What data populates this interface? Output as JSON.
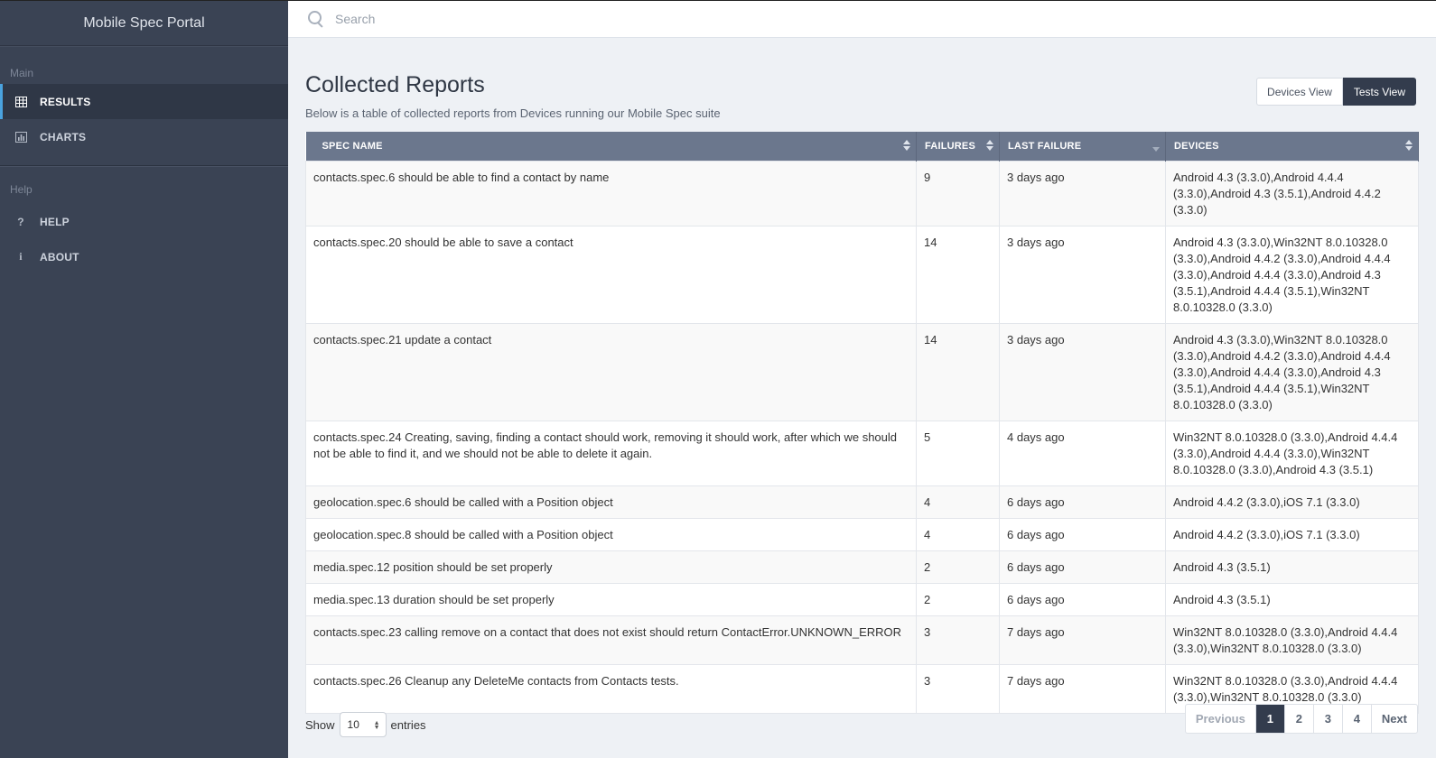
{
  "app": {
    "title": "Mobile Spec Portal"
  },
  "search": {
    "placeholder": "Search",
    "value": ""
  },
  "sidebar": {
    "sections": [
      {
        "label": "Main"
      },
      {
        "label": "Help"
      }
    ],
    "items": [
      {
        "label": "RESULTS",
        "icon": "table-icon",
        "active": true
      },
      {
        "label": "CHARTS",
        "icon": "bar-chart-icon",
        "active": false
      },
      {
        "label": "HELP",
        "icon": "question-icon",
        "active": false
      },
      {
        "label": "ABOUT",
        "icon": "info-icon",
        "active": false
      }
    ]
  },
  "page": {
    "title": "Collected Reports",
    "subtitle": "Below is a table of collected reports from Devices running our Mobile Spec suite",
    "views": [
      {
        "label": "Devices View",
        "active": false
      },
      {
        "label": "Tests View",
        "active": true
      }
    ]
  },
  "table": {
    "columns": [
      "SPEC NAME",
      "FAILURES",
      "LAST FAILURE",
      "DEVICES"
    ],
    "rows": [
      {
        "spec": "contacts.spec.6 should be able to find a contact by name",
        "failures": "9",
        "last": "3 days ago",
        "devices": "Android 4.3 (3.3.0),Android 4.4.4 (3.3.0),Android 4.3 (3.5.1),Android 4.4.2 (3.3.0)"
      },
      {
        "spec": "contacts.spec.20 should be able to save a contact",
        "failures": "14",
        "last": "3 days ago",
        "devices": "Android 4.3 (3.3.0),Win32NT 8.0.10328.0 (3.3.0),Android 4.4.2 (3.3.0),Android 4.4.4 (3.3.0),Android 4.4.4 (3.3.0),Android 4.3 (3.5.1),Android 4.4.4 (3.5.1),Win32NT 8.0.10328.0 (3.3.0)"
      },
      {
        "spec": "contacts.spec.21 update a contact",
        "failures": "14",
        "last": "3 days ago",
        "devices": "Android 4.3 (3.3.0),Win32NT 8.0.10328.0 (3.3.0),Android 4.4.2 (3.3.0),Android 4.4.4 (3.3.0),Android 4.4.4 (3.3.0),Android 4.3 (3.5.1),Android 4.4.4 (3.5.1),Win32NT 8.0.10328.0 (3.3.0)"
      },
      {
        "spec": "contacts.spec.24 Creating, saving, finding a contact should work, removing it should work, after which we should not be able to find it, and we should not be able to delete it again.",
        "failures": "5",
        "last": "4 days ago",
        "devices": "Win32NT 8.0.10328.0 (3.3.0),Android 4.4.4 (3.3.0),Android 4.4.4 (3.3.0),Win32NT 8.0.10328.0 (3.3.0),Android 4.3 (3.5.1)"
      },
      {
        "spec": "geolocation.spec.6 should be called with a Position object",
        "failures": "4",
        "last": "6 days ago",
        "devices": "Android 4.4.2 (3.3.0),iOS 7.1 (3.3.0)"
      },
      {
        "spec": "geolocation.spec.8 should be called with a Position object",
        "failures": "4",
        "last": "6 days ago",
        "devices": "Android 4.4.2 (3.3.0),iOS 7.1 (3.3.0)"
      },
      {
        "spec": "media.spec.12 position should be set properly",
        "failures": "2",
        "last": "6 days ago",
        "devices": "Android 4.3 (3.5.1)"
      },
      {
        "spec": "media.spec.13 duration should be set properly",
        "failures": "2",
        "last": "6 days ago",
        "devices": "Android 4.3 (3.5.1)"
      },
      {
        "spec": "contacts.spec.23 calling remove on a contact that does not exist should return ContactError.UNKNOWN_ERROR",
        "failures": "3",
        "last": "7 days ago",
        "devices": "Win32NT 8.0.10328.0 (3.3.0),Android 4.4.4 (3.3.0),Win32NT 8.0.10328.0 (3.3.0)"
      },
      {
        "spec": "contacts.spec.26 Cleanup any DeleteMe contacts from Contacts tests.",
        "failures": "3",
        "last": "7 days ago",
        "devices": "Win32NT 8.0.10328.0 (3.3.0),Android 4.4.4 (3.3.0),Win32NT 8.0.10328.0 (3.3.0)"
      }
    ]
  },
  "footer": {
    "show_label": "Show",
    "entries_label": "entries",
    "length_value": "10",
    "pagination": {
      "previous": "Previous",
      "pages": [
        "1",
        "2",
        "3",
        "4"
      ],
      "current": "1",
      "next": "Next"
    }
  },
  "colors": {
    "sidebar_bg": "#3a4354",
    "active_accent": "#4aa3df",
    "table_header": "#6b778d",
    "dark_button": "#333c4d"
  }
}
